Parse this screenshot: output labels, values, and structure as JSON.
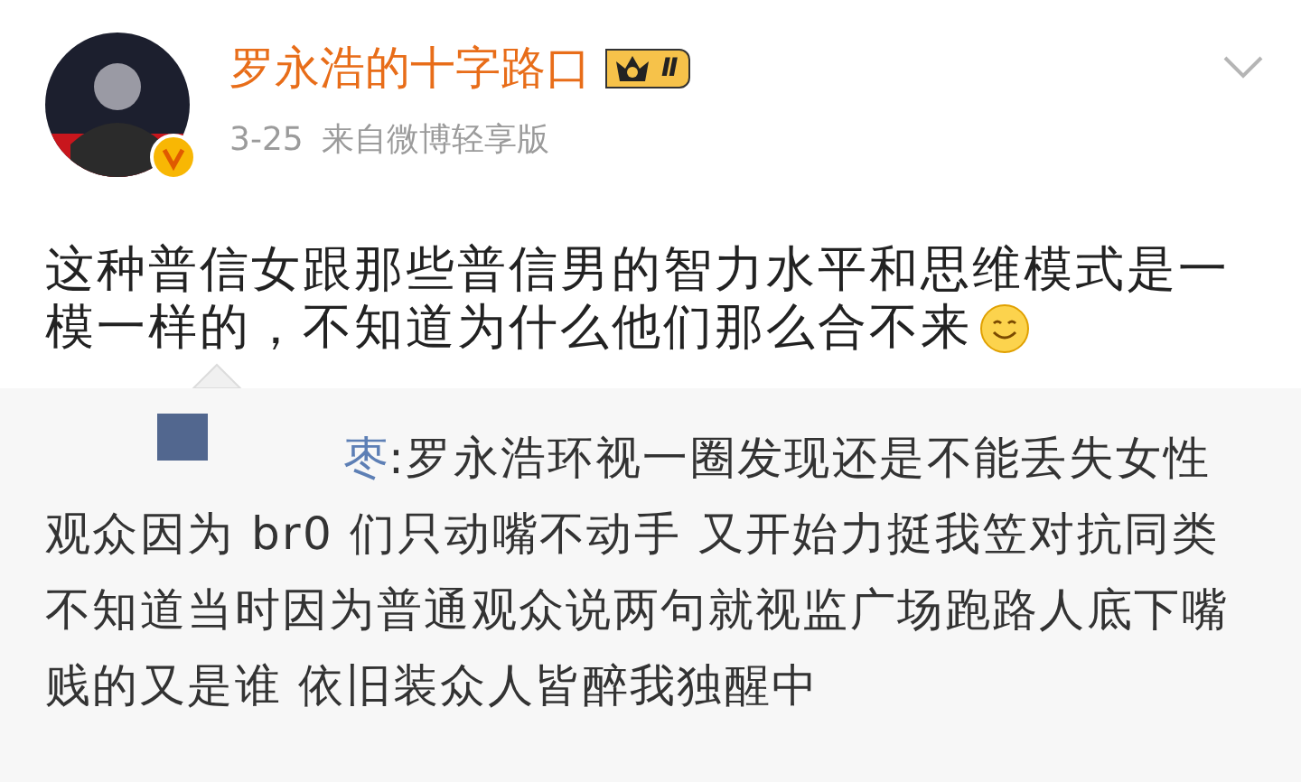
{
  "post": {
    "author": "罗永浩的十字路口",
    "badge": "Ⅱ",
    "time": "3-25",
    "source": "来自微博轻享版",
    "text_lines": [
      "这种普信女跟那些普信男的智力水平和思维模式是一",
      "模一样的，不知道为什么他们那么合不来"
    ]
  },
  "repost": {
    "user": "枣",
    "separator": ":",
    "lines": [
      "罗永浩环视一圈发现还是不能丢失女性",
      "观众因为 br0 们只动嘴不动手 又开始力挺我笠对抗同类",
      "不知道当时因为普通观众说两句就视监广场跑路人底下嘴",
      "贱的又是谁 依旧装众人皆醉我独醒中"
    ]
  }
}
